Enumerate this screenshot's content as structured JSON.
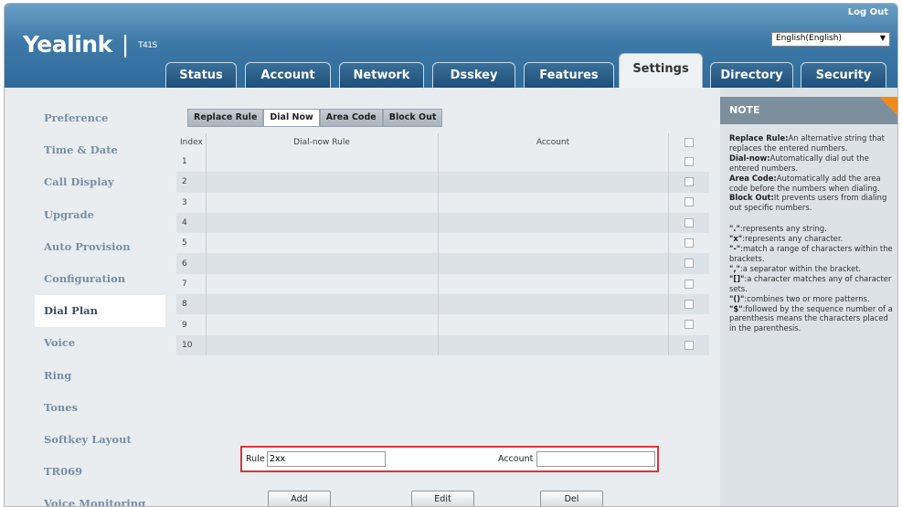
{
  "header": {
    "logo_text": "Yealink",
    "logo_divider": "|",
    "model": "T41S",
    "logout": "Log Out",
    "language": "English(English)"
  },
  "tabs": [
    {
      "label": "Status"
    },
    {
      "label": "Account"
    },
    {
      "label": "Network"
    },
    {
      "label": "Dsskey"
    },
    {
      "label": "Features"
    },
    {
      "label": "Settings",
      "active": true
    },
    {
      "label": "Directory"
    },
    {
      "label": "Security"
    }
  ],
  "sidebar": {
    "items": [
      {
        "label": "Preference"
      },
      {
        "label": "Time & Date"
      },
      {
        "label": "Call Display"
      },
      {
        "label": "Upgrade"
      },
      {
        "label": "Auto Provision"
      },
      {
        "label": "Configuration"
      },
      {
        "label": "Dial Plan",
        "active": true
      },
      {
        "label": "Voice"
      },
      {
        "label": "Ring"
      },
      {
        "label": "Tones"
      },
      {
        "label": "Softkey Layout"
      },
      {
        "label": "TR069"
      },
      {
        "label": "Voice Monitoring"
      }
    ]
  },
  "subtabs": [
    {
      "label": "Replace Rule"
    },
    {
      "label": "Dial Now",
      "active": true
    },
    {
      "label": "Area Code"
    },
    {
      "label": "Block Out"
    }
  ],
  "table": {
    "headers": {
      "index": "Index",
      "rule": "Dial-now Rule",
      "account": "Account"
    },
    "rows": [
      {
        "index": "1"
      },
      {
        "index": "2"
      },
      {
        "index": "3"
      },
      {
        "index": "4"
      },
      {
        "index": "5"
      },
      {
        "index": "6"
      },
      {
        "index": "7"
      },
      {
        "index": "8"
      },
      {
        "index": "9"
      },
      {
        "index": "10"
      }
    ]
  },
  "form": {
    "rule_label": "Rule",
    "rule_value": "2xx",
    "account_label": "Account",
    "account_value": ""
  },
  "buttons": {
    "add": "Add",
    "edit": "Edit",
    "del": "Del"
  },
  "note": {
    "title": "NOTE",
    "items": [
      {
        "term": "Replace Rule:",
        "text": "An alternative string that replaces the entered numbers."
      },
      {
        "term": "Dial-now:",
        "text": "Automatically dial out the entered numbers."
      },
      {
        "term": "Area Code:",
        "text": "Automatically add the area code before the numbers when dialing."
      },
      {
        "term": "Block Out:",
        "text": "It prevents users from dialing out specific numbers."
      }
    ],
    "symbols": [
      {
        "term": "\".\"",
        "text": ":represents any string."
      },
      {
        "term": "\"x\"",
        "text": ":represents any character."
      },
      {
        "term": "\"-\"",
        "text": ":match a range of characters within the brackets."
      },
      {
        "term": "\",\"",
        "text": ":a separator within the bracket."
      },
      {
        "term": "\"[]\"",
        "text": ":a character matches any of character sets."
      },
      {
        "term": "\"()\"",
        "text": ":combines two or more patterns."
      },
      {
        "term": "\"$\"",
        "text": ":followed by the sequence number of a parenthesis means the characters placed in the parenthesis."
      }
    ]
  }
}
